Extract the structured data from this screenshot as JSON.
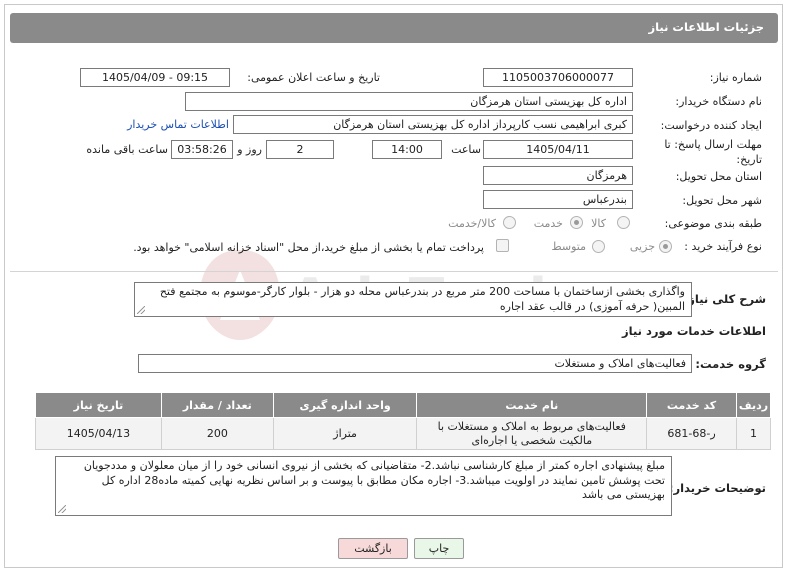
{
  "header": {
    "title": "جزئیات اطلاعات نیاز"
  },
  "fields": {
    "need_number_label": "شماره نیاز:",
    "need_number": "1105003706000077",
    "announce_label": "تاریخ و ساعت اعلان عمومی:",
    "announce_value": "1405/04/09 - 09:15",
    "buyer_org_label": "نام دستگاه خریدار:",
    "buyer_org": "اداره کل بهزیستی استان هرمزگان",
    "requester_label": "ایجاد کننده درخواست:",
    "requester": "کبری  ابراهیمی نسب کارپرداز اداره کل بهزیستی استان هرمزگان",
    "contact_link": "اطلاعات تماس خریدار",
    "deadline_label": "مهلت ارسال پاسخ: تا تاریخ:",
    "deadline_date": "1405/04/11",
    "time_label": "ساعت",
    "deadline_time": "14:00",
    "days_value": "2",
    "days_label": "روز و",
    "remaining_time": "03:58:26",
    "remaining_label": "ساعت باقی مانده",
    "province_label": "استان محل تحویل:",
    "province": "هرمزگان",
    "city_label": "شهر محل تحویل:",
    "city": "بندرعباس",
    "category_label": "طبقه بندی موضوعی:",
    "category_options": [
      "کالا",
      "خدمت",
      "کالا/خدمت"
    ],
    "process_label": "نوع فرآیند خرید :",
    "process_options": [
      "جزیی",
      "متوسط"
    ],
    "payment_note": "پرداخت تمام یا بخشی از مبلغ خرید،از محل \"اسناد خزانه اسلامی\" خواهد بود."
  },
  "summary": {
    "label": "شرح کلی نیاز:",
    "text": "واگذاری بخشی ازساختمان با مساحت 200 متر مربع در بندرعباس محله دو هزار - بلوار کارگر-موسوم به مجتمع فتح المبین( حرفه آموزی) در قالب عقد اجاره"
  },
  "services": {
    "section_title": "اطلاعات خدمات مورد نیاز",
    "group_label": "گروه خدمت:",
    "group_value": "فعالیت‌های  املاک و مستغلات",
    "columns": [
      "ردیف",
      "کد خدمت",
      "نام خدمت",
      "واحد اندازه گیری",
      "تعداد / مقدار",
      "تاریخ نیاز"
    ],
    "rows": [
      [
        "1",
        "ر-68-681",
        "فعالیت‌های مربوط به املاک و مستغلات با مالکیت شخصی یا اجاره‌ای",
        "متراژ",
        "200",
        "1405/04/13"
      ]
    ]
  },
  "buyer_notes": {
    "label": "توضیحات خریدار:",
    "text": "مبلغ پیشنهادی  اجاره کمتر از مبلغ کارشناسی نباشد.2- متقاضیانی که بخشی از نیروی انسانی خود را از میان معلولان و مددجویان تحت پوشش تامین نمایند در اولویت میباشد.3-  اجاره مکان  مطابق با پیوست و بر اساس نظریه نهایی کمیته ماده28 اداره کل بهزیستی می باشد"
  },
  "buttons": {
    "print": "چاپ",
    "back": "بازگشت"
  },
  "watermark": {
    "text": "AriaTender.neT"
  },
  "colors": {
    "header_bg": "#8a8a8a",
    "link": "#1a4fb5",
    "back_btn_bg": "#f7d9d9",
    "print_btn_bg": "#e8f7e8"
  }
}
